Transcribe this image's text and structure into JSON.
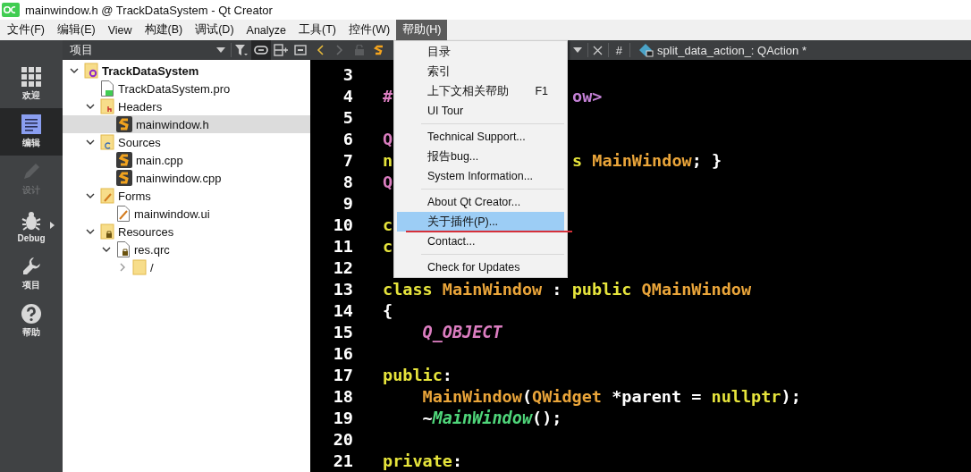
{
  "window": {
    "title": "mainwindow.h @ TrackDataSystem - Qt Creator"
  },
  "menus": [
    {
      "label": "文件(F)",
      "selected": false
    },
    {
      "label": "编辑(E)",
      "selected": false
    },
    {
      "label": "View",
      "selected": false
    },
    {
      "label": "构建(B)",
      "selected": false
    },
    {
      "label": "调试(D)",
      "selected": false
    },
    {
      "label": "Analyze",
      "selected": false
    },
    {
      "label": "工具(T)",
      "selected": false
    },
    {
      "label": "控件(W)",
      "selected": false
    },
    {
      "label": "帮助(H)",
      "selected": true
    }
  ],
  "mode_bar": [
    {
      "kind": "welcome",
      "label": "欢迎",
      "selected": false,
      "disabled": false
    },
    {
      "kind": "edit",
      "label": "编辑",
      "selected": true,
      "disabled": false
    },
    {
      "kind": "design",
      "label": "设计",
      "selected": false,
      "disabled": true
    },
    {
      "kind": "debug",
      "label": "Debug",
      "selected": false,
      "disabled": false
    },
    {
      "kind": "projects",
      "label": "项目",
      "selected": false,
      "disabled": false
    },
    {
      "kind": "help",
      "label": "帮助",
      "selected": false,
      "disabled": false
    }
  ],
  "project_pane": {
    "title": "项目",
    "tree": [
      {
        "kind": "project",
        "label": "TrackDataSystem",
        "selected": false,
        "expanded": true,
        "children": [
          {
            "kind": "pro",
            "label": "TrackDataSystem.pro",
            "selected": false
          },
          {
            "kind": "headers",
            "label": "Headers",
            "selected": false,
            "expanded": true,
            "children": [
              {
                "kind": "source",
                "label": "mainwindow.h",
                "selected": true
              }
            ]
          },
          {
            "kind": "sources",
            "label": "Sources",
            "selected": false,
            "expanded": true,
            "children": [
              {
                "kind": "source",
                "label": "main.cpp",
                "selected": false
              },
              {
                "kind": "source",
                "label": "mainwindow.cpp",
                "selected": false
              }
            ]
          },
          {
            "kind": "forms",
            "label": "Forms",
            "selected": false,
            "expanded": true,
            "children": [
              {
                "kind": "ui",
                "label": "mainwindow.ui",
                "selected": false
              }
            ]
          },
          {
            "kind": "resources",
            "label": "Resources",
            "selected": false,
            "expanded": true,
            "children": [
              {
                "kind": "qrc",
                "label": "res.qrc",
                "selected": false,
                "expanded": true,
                "children": [
                  {
                    "kind": "folder",
                    "label": "/",
                    "selected": false,
                    "expanded": false
                  }
                ]
              }
            ]
          }
        ]
      }
    ]
  },
  "editor_toolbar": {
    "hash": "#",
    "symbol": "split_data_action_: QAction *"
  },
  "code": [
    {
      "number": "3"
    },
    {
      "number": "4",
      "indented": false,
      "tokens": [
        {
          "kind": "macro",
          "text": "#"
        }
      ],
      "tail": [
        {
          "kind": "include",
          "text": "ow>"
        }
      ]
    },
    {
      "number": "5"
    },
    {
      "number": "6",
      "indented": false,
      "tokens": [
        {
          "kind": "macro",
          "text": "Q"
        }
      ]
    },
    {
      "number": "7",
      "indented": false,
      "tokens": [
        {
          "kind": "keyword",
          "text": "n"
        }
      ],
      "tail": [
        {
          "kind": "keyword",
          "text": "s "
        },
        {
          "kind": "type",
          "text": "MainWindow"
        },
        {
          "kind": "plain",
          "text": "; }"
        }
      ]
    },
    {
      "number": "8",
      "indented": false,
      "tokens": [
        {
          "kind": "macro",
          "text": "Q"
        }
      ]
    },
    {
      "number": "9"
    },
    {
      "number": "10",
      "indented": false,
      "tokens": [
        {
          "kind": "keyword",
          "text": "c"
        }
      ]
    },
    {
      "number": "11",
      "indented": false,
      "tokens": [
        {
          "kind": "keyword",
          "text": "c"
        }
      ]
    },
    {
      "number": "12"
    },
    {
      "number": "13",
      "indented": false,
      "tokens": [
        {
          "kind": "keyword",
          "text": "class "
        },
        {
          "kind": "type",
          "text": "MainWindow"
        },
        {
          "kind": "plain",
          "text": " : "
        },
        {
          "kind": "keyword",
          "text": "public "
        },
        {
          "kind": "type",
          "text": "QMainWindow"
        }
      ]
    },
    {
      "number": "14",
      "indented": false,
      "tokens": [
        {
          "kind": "plain",
          "text": "{"
        }
      ]
    },
    {
      "number": "15",
      "indented": true,
      "tokens": [
        {
          "kind": "macro-italic",
          "text": "Q_OBJECT"
        }
      ]
    },
    {
      "number": "16"
    },
    {
      "number": "17",
      "indented": false,
      "tokens": [
        {
          "kind": "keyword",
          "text": "public"
        },
        {
          "kind": "plain",
          "text": ":"
        }
      ]
    },
    {
      "number": "18",
      "indented": true,
      "tokens": [
        {
          "kind": "type",
          "text": "MainWindow"
        },
        {
          "kind": "plain",
          "text": "("
        },
        {
          "kind": "type",
          "text": "QWidget"
        },
        {
          "kind": "plain",
          "text": " *parent = "
        },
        {
          "kind": "keyword",
          "text": "nullptr"
        },
        {
          "kind": "plain",
          "text": ");"
        }
      ]
    },
    {
      "number": "19",
      "indented": true,
      "tokens": [
        {
          "kind": "plain",
          "text": "~"
        },
        {
          "kind": "declaration",
          "text": "MainWindow"
        },
        {
          "kind": "plain",
          "text": "();"
        }
      ]
    },
    {
      "number": "20"
    },
    {
      "number": "21",
      "indented": false,
      "tokens": [
        {
          "kind": "keyword",
          "text": "private"
        },
        {
          "kind": "plain",
          "text": ":"
        }
      ]
    }
  ],
  "help_menu": [
    {
      "kind": "item",
      "label": "目录",
      "selected": false
    },
    {
      "kind": "item",
      "label": "索引",
      "selected": false
    },
    {
      "kind": "item",
      "label": "上下文相关帮助",
      "shortcut": "F1",
      "selected": false
    },
    {
      "kind": "item",
      "label": "UI Tour",
      "selected": false
    },
    {
      "kind": "separator"
    },
    {
      "kind": "item",
      "label": "Technical Support...",
      "selected": false
    },
    {
      "kind": "item",
      "label": "报告bug...",
      "selected": false
    },
    {
      "kind": "item",
      "label": "System Information...",
      "selected": false
    },
    {
      "kind": "separator"
    },
    {
      "kind": "item",
      "label": "About Qt Creator...",
      "selected": false
    },
    {
      "kind": "item",
      "label": "关于插件(P)...",
      "selected": true,
      "underlined": true
    },
    {
      "kind": "item",
      "label": "Contact...",
      "selected": false
    },
    {
      "kind": "separator"
    },
    {
      "kind": "item",
      "label": "Check for Updates",
      "selected": false
    }
  ]
}
